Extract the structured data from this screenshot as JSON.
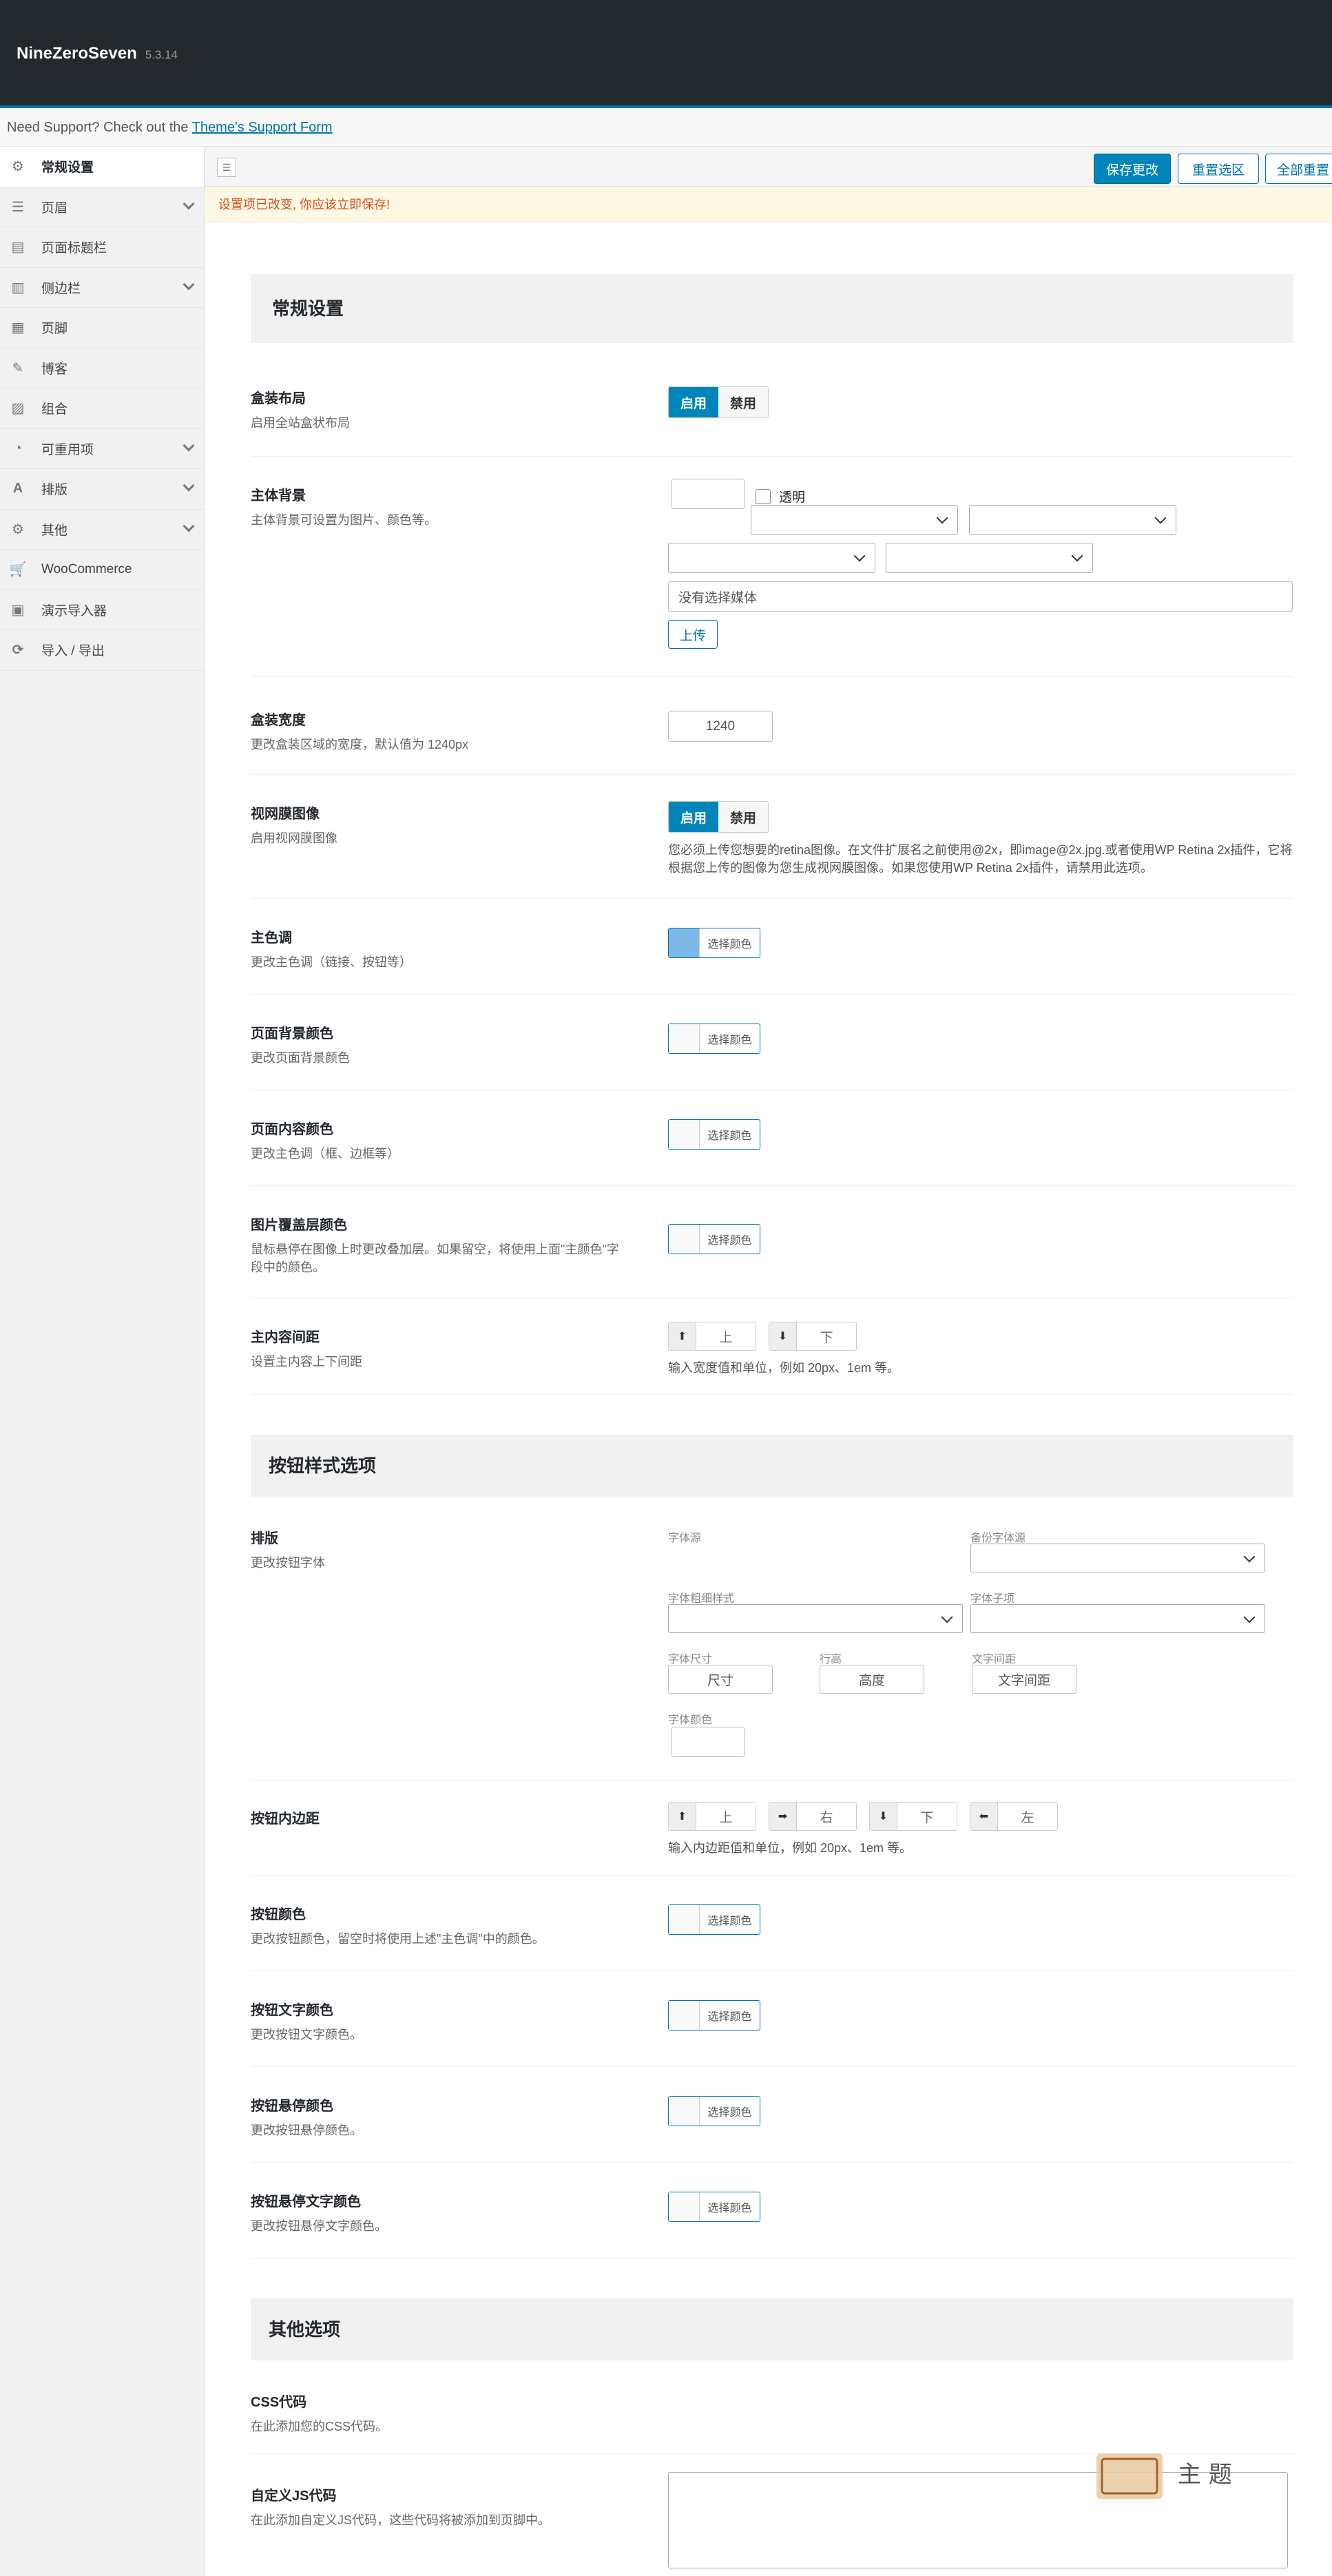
{
  "header": {
    "brand": "NineZeroSeven",
    "version": "5.3.14"
  },
  "support": {
    "prefix": "Need Support? Check out the ",
    "link": "Theme's Support Form"
  },
  "sidebar": {
    "items": [
      {
        "label": "常规设置",
        "icon": "gear-icon",
        "active": true,
        "chev": false
      },
      {
        "label": "页眉",
        "icon": "sliders-icon",
        "chev": true
      },
      {
        "label": "页面标题栏",
        "icon": "list-icon",
        "chev": false
      },
      {
        "label": "侧边栏",
        "icon": "columns-icon",
        "chev": true
      },
      {
        "label": "页脚",
        "icon": "grid-icon",
        "chev": false
      },
      {
        "label": "博客",
        "icon": "pencil-icon",
        "chev": false
      },
      {
        "label": "组合",
        "icon": "image-icon",
        "chev": false
      },
      {
        "label": "可重用项",
        "icon": "pie-icon",
        "chev": true
      },
      {
        "label": "排版",
        "icon": "font-icon",
        "chev": true
      },
      {
        "label": "其他",
        "icon": "cog-icon",
        "chev": true
      },
      {
        "label": "WooCommerce",
        "icon": "cart-icon",
        "chev": false
      },
      {
        "label": "演示导入器",
        "icon": "window-icon",
        "chev": false
      },
      {
        "label": "导入 / 导出",
        "icon": "refresh-icon",
        "chev": false
      }
    ]
  },
  "toolbar": {
    "save": "保存更改",
    "reset_section": "重置选区",
    "reset_all": "全部重置"
  },
  "notice": "设置项已改变, 你应该立即保存!",
  "general": {
    "title": "常规设置",
    "boxed": {
      "title": "盒装布局",
      "desc": "启用全站盒状布局",
      "on": "启用",
      "off": "禁用"
    },
    "bg": {
      "title": "主体背景",
      "desc": "主体背景可设置为图片、颜色等。",
      "transparent": "透明",
      "media": "没有选择媒体",
      "upload": "上传"
    },
    "width": {
      "title": "盒装宽度",
      "desc": "更改盒装区域的宽度，默认值为 1240px",
      "value": "1240"
    },
    "retina": {
      "title": "视网膜图像",
      "desc": "启用视网膜图像",
      "on": "启用",
      "off": "禁用",
      "note": "您必须上传您想要的retina图像。在文件扩展名之前使用@2x，即image@2x.jpg.或者使用WP Retina 2x插件，它将根据您上传的图像为您生成视网膜图像。如果您使用WP Retina 2x插件，请禁用此选项。"
    },
    "main_color": {
      "title": "主色调",
      "desc": "更改主色调（链接、按钮等）",
      "button": "选择颜色",
      "swatch": "#7db9e8"
    },
    "page_bg": {
      "title": "页面背景颜色",
      "desc": "更改页面背景颜色",
      "button": "选择颜色"
    },
    "content_color": {
      "title": "页面内容颜色",
      "desc": "更改主色调（框、边框等）",
      "button": "选择颜色"
    },
    "overlay": {
      "title": "图片覆盖层颜色",
      "desc": "鼠标悬停在图像上时更改叠加层。如果留空，将使用上面\"主颜色\"字段中的颜色。",
      "button": "选择颜色"
    },
    "spacing": {
      "title": "主内容间距",
      "desc": "设置主内容上下间距",
      "top": "上",
      "bottom": "下",
      "note": "输入宽度值和单位，例如 20px、1em 等。"
    }
  },
  "buttons": {
    "title": "按钮样式选项",
    "typo": {
      "title": "排版",
      "desc": "更改按钮字体",
      "font_source": "字体源",
      "backup_font": "备份字体源",
      "weight": "字体粗细样式",
      "subset": "字体子项",
      "size": "字体尺寸",
      "line_height": "行高",
      "spacing": "文字间距",
      "color": "字体颜色",
      "size_ph": "尺寸",
      "lh_ph": "高度",
      "sp_ph": "文字间距"
    },
    "padding": {
      "title": "按钮内边距",
      "top": "上",
      "right": "右",
      "bottom": "下",
      "left": "左",
      "note": "输入内边距值和单位，例如 20px、1em 等。"
    },
    "color": {
      "title": "按钮颜色",
      "desc": "更改按钮颜色，留空时将使用上述\"主色调\"中的颜色。",
      "button": "选择颜色"
    },
    "text_color": {
      "title": "按钮文字颜色",
      "desc": "更改按钮文字颜色。",
      "button": "选择颜色"
    },
    "hover": {
      "title": "按钮悬停颜色",
      "desc": "更改按钮悬停颜色。",
      "button": "选择颜色"
    },
    "hover_text": {
      "title": "按钮悬停文字颜色",
      "desc": "更改按钮悬停文字颜色。",
      "button": "选择颜色"
    }
  },
  "other": {
    "title": "其他选项",
    "css": {
      "title": "CSS代码",
      "desc": "在此添加您的CSS代码。"
    },
    "js": {
      "title": "自定义JS代码",
      "desc": "在此添加自定义JS代码，这些代码将被添加到页脚中。"
    }
  },
  "colors": {
    "accent": "#0085ba",
    "header": "#23282d"
  }
}
